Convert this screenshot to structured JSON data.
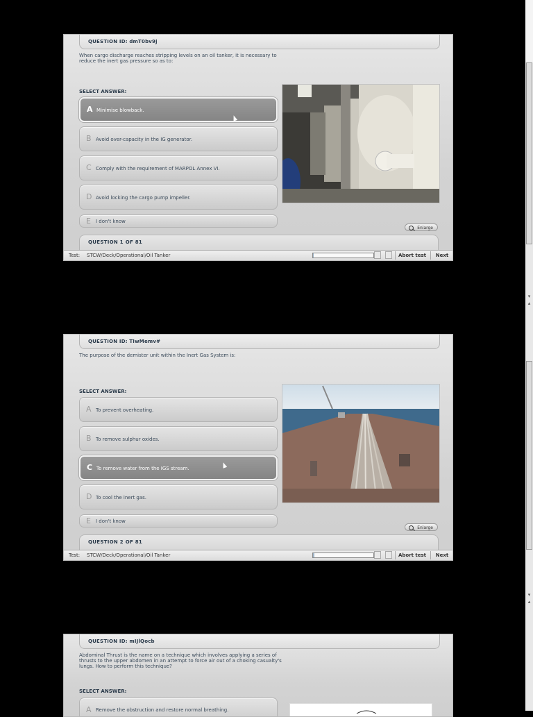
{
  "questions": [
    {
      "id_label": "QUESTION ID: dmT0bv9j",
      "text": "When cargo discharge reaches stripping levels on an oil tanker, it is necessary to reduce the inert gas pressure so as to:",
      "select_label": "SELECT ANSWER:",
      "options": [
        {
          "letter": "A",
          "text": "Minimise blowback."
        },
        {
          "letter": "B",
          "text": "Avoid over-capacity in the IG generator."
        },
        {
          "letter": "C",
          "text": "Comply with the requirement of MARPOL Annex VI."
        },
        {
          "letter": "D",
          "text": "Avoid locking the cargo pump impeller."
        },
        {
          "letter": "E",
          "text": "I don't know"
        }
      ],
      "selected": "A",
      "image_desc": "engine-room-ig-equipment",
      "enlarge_label": "Enlarge",
      "counter": "QUESTION  1  OF 81"
    },
    {
      "id_label": "QUESTION ID: TIwMemv#",
      "text": "The purpose of the demister unit within the Inert Gas System is:",
      "select_label": "SELECT ANSWER:",
      "options": [
        {
          "letter": "A",
          "text": "To prevent overheating."
        },
        {
          "letter": "B",
          "text": "To remove sulphur oxides."
        },
        {
          "letter": "C",
          "text": "To remove water from the IGS stream."
        },
        {
          "letter": "D",
          "text": "To cool the inert gas."
        },
        {
          "letter": "E",
          "text": "I don't know"
        }
      ],
      "selected": "C",
      "image_desc": "tanker-deck-photo",
      "enlarge_label": "Enlarge",
      "counter": "QUESTION  2  OF 81"
    },
    {
      "id_label": "QUESTION ID: mIJlQocb",
      "text": "Abdominal Thrust is the name on a technique which involves applying a series of thrusts to the upper abdomen in an attempt to force air out of a choking casualty's lungs. How to  perform this technique?",
      "select_label": "SELECT ANSWER:",
      "options": [
        {
          "letter": "A",
          "text": "Remove the obstruction and restore normal breathing."
        }
      ]
    }
  ],
  "status_bar": {
    "test_label": "Test:",
    "test_value": "STCW/Deck/Operational/Oil Tanker",
    "abort_label": "Abort test",
    "next_label": "Next"
  },
  "progress": [
    0.01,
    0.02
  ],
  "colors": {
    "background": "#000000",
    "panel": "#d8d8d8",
    "selected_option": "#8f8f8f",
    "text": "#3a4a5a"
  }
}
